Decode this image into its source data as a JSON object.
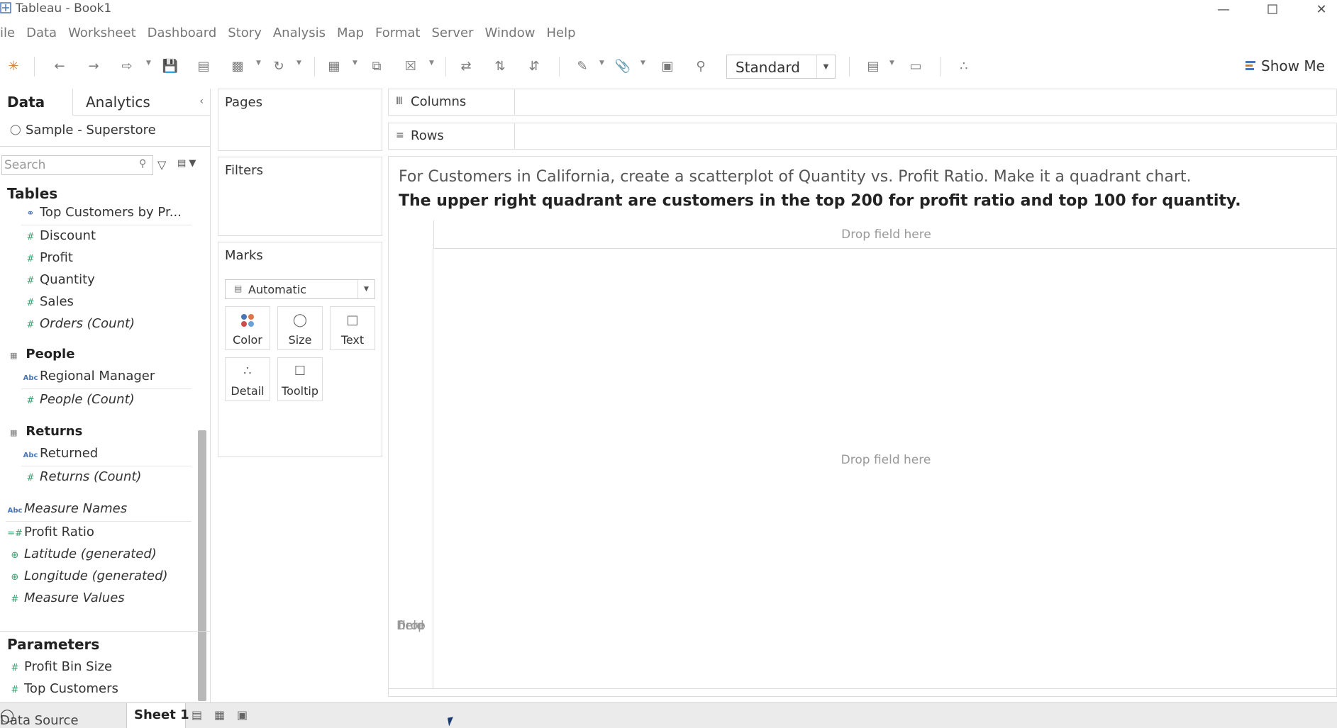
{
  "window": {
    "title": "Tableau - Book1",
    "minimize_icon": "minimize-icon",
    "maximize_icon": "maximize-icon",
    "close_icon": "close-icon"
  },
  "menu": [
    "ile",
    "Data",
    "Worksheet",
    "Dashboard",
    "Story",
    "Analysis",
    "Map",
    "Format",
    "Server",
    "Window",
    "Help"
  ],
  "toolbar": {
    "fit_select": "Standard",
    "show_me": "Show Me"
  },
  "data_pane": {
    "tab_data": "Data",
    "tab_analytics": "Analytics",
    "datasource": "Sample - Superstore",
    "search_placeholder": "Search",
    "tables_header": "Tables",
    "fields": {
      "top_customers_set": "Top Customers by Pr...",
      "discount": "Discount",
      "profit": "Profit",
      "quantity": "Quantity",
      "sales": "Sales",
      "orders_count": "Orders (Count)"
    },
    "people": {
      "header": "People",
      "regional_manager": "Regional Manager",
      "people_count": "People (Count)"
    },
    "returns": {
      "header": "Returns",
      "returned": "Returned",
      "returns_count": "Returns (Count)"
    },
    "measure_names": "Measure Names",
    "profit_ratio": "Profit Ratio",
    "latitude": "Latitude (generated)",
    "longitude": "Longitude (generated)",
    "measure_values": "Measure Values",
    "parameters_header": "Parameters",
    "param_profit_bin": "Profit Bin Size",
    "param_top_customers": "Top Customers"
  },
  "cards": {
    "pages": "Pages",
    "filters": "Filters",
    "marks": "Marks",
    "mark_type": "Automatic",
    "color": "Color",
    "size": "Size",
    "text": "Text",
    "detail": "Detail",
    "tooltip": "Tooltip"
  },
  "shelves": {
    "columns": "Columns",
    "rows": "Rows"
  },
  "view": {
    "task_line1": "For Customers in California, create a scatterplot of Quantity vs. Profit Ratio. Make it a quadrant chart.",
    "task_line2": "The upper right quadrant are customers in the top 200 for profit ratio and top 100 for quantity.",
    "drop_field": "Drop field here",
    "drop_left_1": "Drop",
    "drop_left_2": "field",
    "drop_left_3": "here"
  },
  "tabs_bar": {
    "data_source": "Data Source",
    "sheet1": "Sheet 1"
  }
}
